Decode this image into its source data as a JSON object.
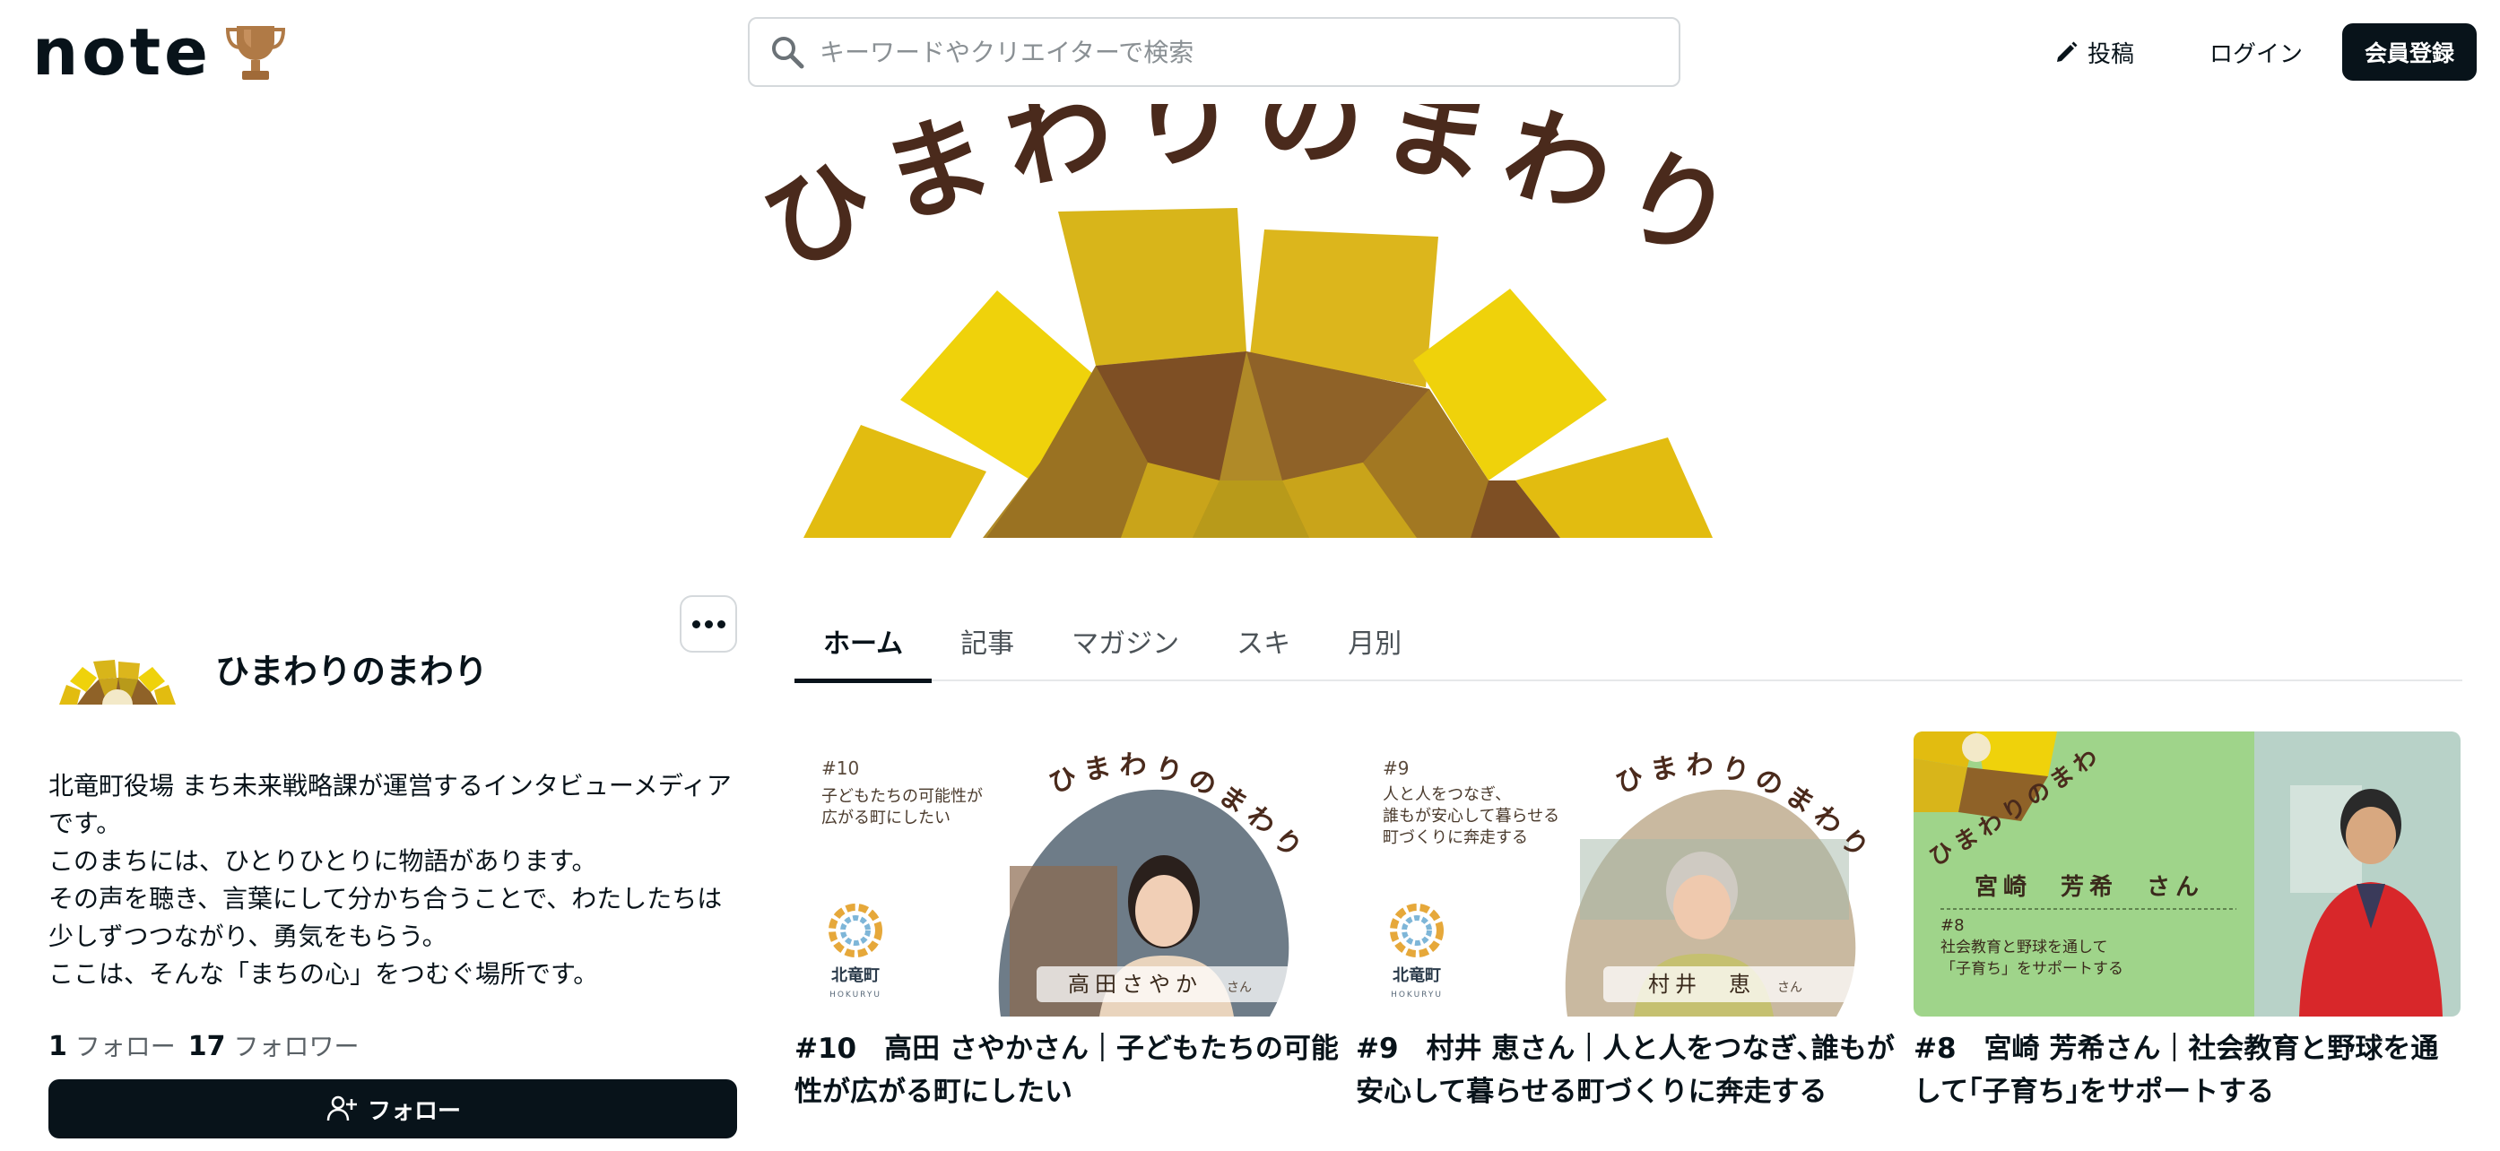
{
  "header": {
    "logo_text": "note",
    "search_placeholder": "キーワードやクリエイターで検索",
    "post_label": "投稿",
    "login_label": "ログイン",
    "signup_label": "会員登録"
  },
  "banner": {
    "title_text": "ひまわりのまわり"
  },
  "profile": {
    "name": "ひまわりのまわり",
    "bio_lines": [
      "北竜町役場 まち未来戦略課が運営するインタビューメディアです。",
      "このまちには、ひとりひとりに物語があります。",
      "その声を聴き、言葉にして分かち合うことで、わたしたちは少しずつつながり、勇気をもらう。",
      "ここは、そんな「まちの心」をつむぐ場所です。"
    ],
    "following_count": "1",
    "following_label": "フォロー",
    "followers_count": "17",
    "followers_label": "フォロワー",
    "follow_button_label": "フォロー"
  },
  "tabs": [
    {
      "label": "ホーム",
      "active": true
    },
    {
      "label": "記事",
      "active": false
    },
    {
      "label": "マガジン",
      "active": false
    },
    {
      "label": "スキ",
      "active": false
    },
    {
      "label": "月別",
      "active": false
    }
  ],
  "cards": [
    {
      "title": "#10　高田 さやかさん｜子どもたちの可能性が広がる町にしたい",
      "thumb_number": "#10",
      "thumb_caption_1": "子どもたちの可能性が",
      "thumb_caption_2": "広がる町にしたい",
      "thumb_logo_text": "ひまわりのまわり",
      "thumb_town": "北竜町",
      "thumb_town_en": "HOKURYU",
      "thumb_person": "高田さやか",
      "thumb_honorific": "さん"
    },
    {
      "title": "#9　村井 恵さん｜人と人をつなぎ､誰もが安心して暮らせる町づくりに奔走する",
      "thumb_number": "#9",
      "thumb_caption_1": "人と人をつなぎ、",
      "thumb_caption_2": "誰もが安心して暮らせる",
      "thumb_caption_3": "町づくりに奔走する",
      "thumb_logo_text": "ひまわりのまわり",
      "thumb_town": "北竜町",
      "thumb_town_en": "HOKURYU",
      "thumb_person": "村井　恵",
      "thumb_honorific": "さん"
    },
    {
      "title": "#8　宮崎 芳希さん｜社会教育と野球を通して｢子育ち｣をサポートする",
      "thumb_logo_text": "ひまわりのまわり",
      "thumb_person": "宮崎　芳希　さん",
      "thumb_number": "#8",
      "thumb_caption_1": "社会教育と野球を通して",
      "thumb_caption_2": "「子育ち」をサポートする"
    }
  ],
  "colors": {
    "ink": "#08131a",
    "sun_yellow": "#f0d10c",
    "sun_gold": "#d8b21a",
    "sun_brown": "#8a5a22",
    "title_brown": "#4a2a1c",
    "card3_green": "#9fd48a"
  }
}
